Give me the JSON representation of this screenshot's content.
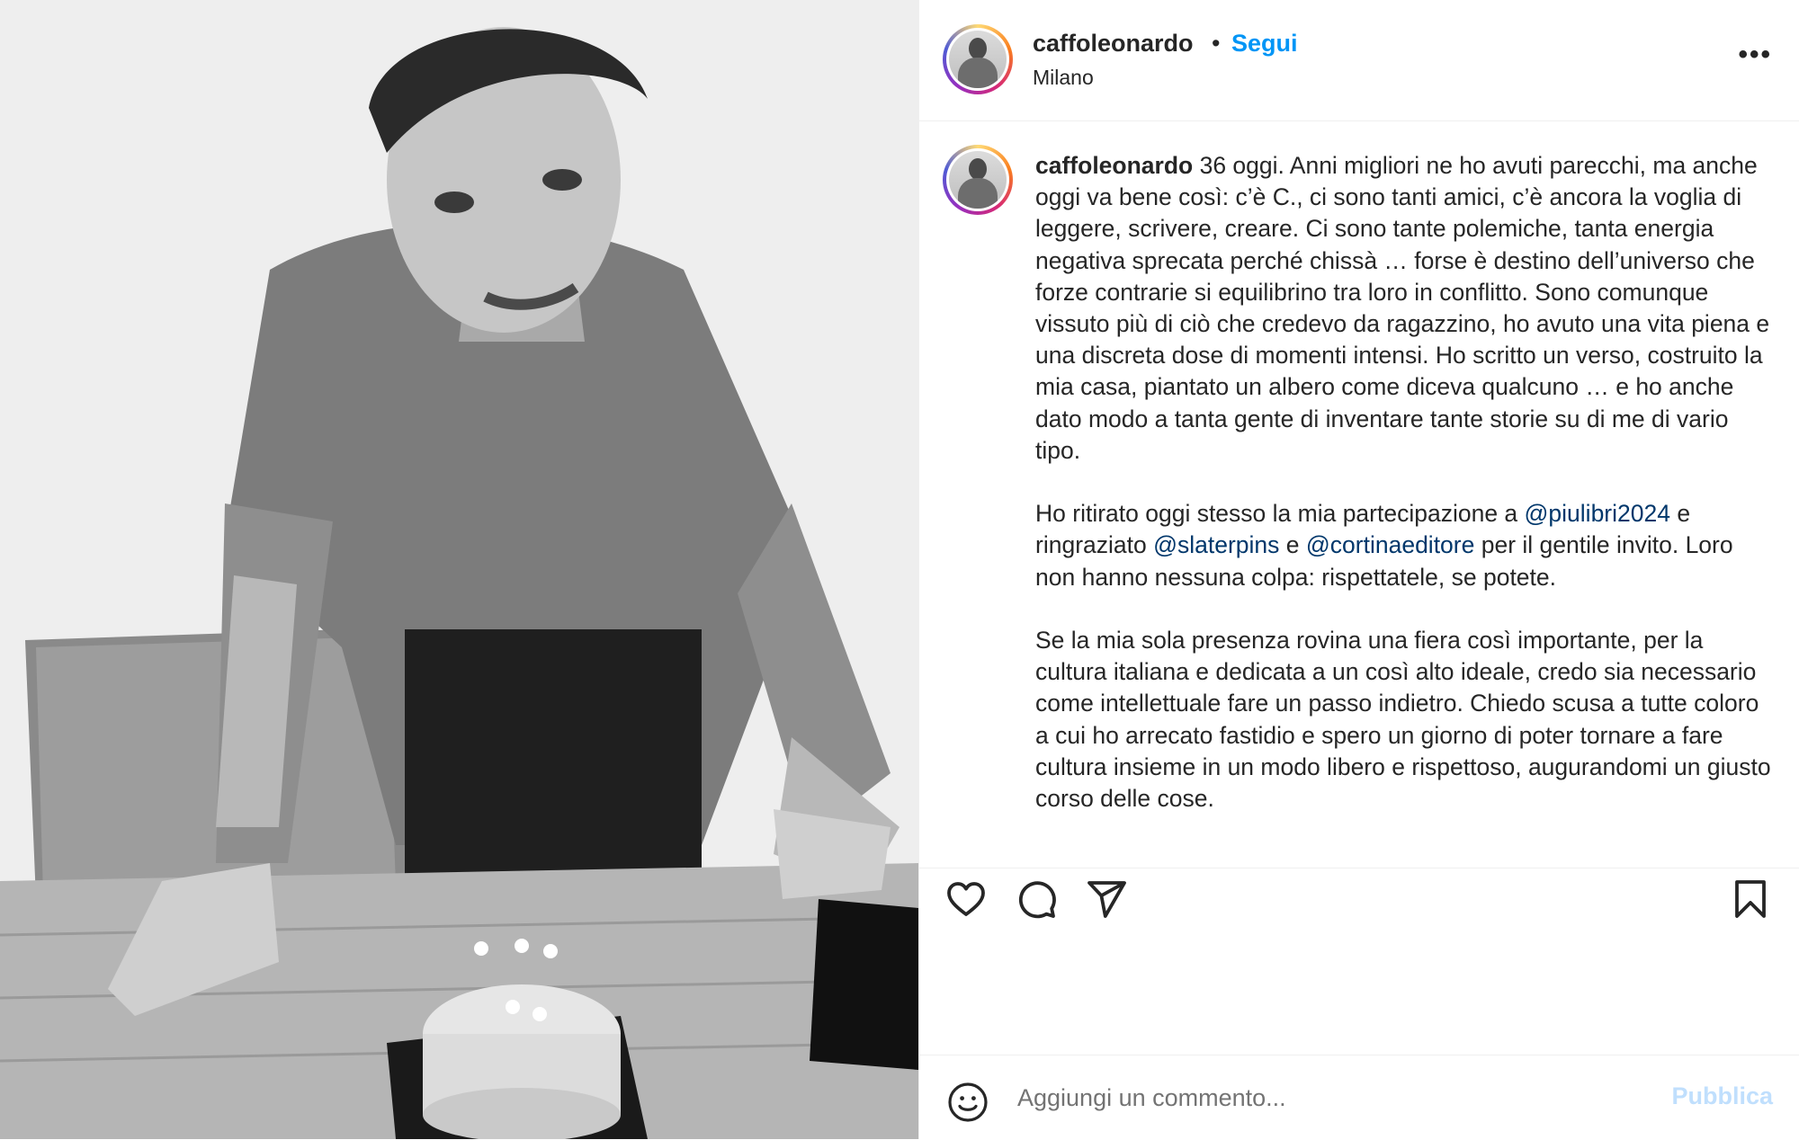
{
  "post_image": {
    "alt_subject": "photo"
  },
  "header": {
    "username": "caffoleonardo",
    "separator": "•",
    "follow_label": "Segui",
    "location": "Milano",
    "more_label": "•••"
  },
  "caption": {
    "username": "caffoleonardo",
    "p1": " 36 oggi. Anni migliori ne ho avuti parecchi, ma anche oggi va bene così: c’è C., ci sono tanti amici, c’è ancora la voglia di leggere, scrivere, creare. Ci sono tante polemiche, tanta energia negativa sprecata perché chissà … forse è destino dell’universo che forze contrarie si equilibrino tra loro in conflitto. Sono comunque vissuto più di ciò che credevo da ragazzino, ho avuto una vita piena e una discreta dose di momenti intensi. Ho scritto un verso, costruito la mia casa, piantato un albero come diceva qualcuno … e ho anche dato modo a tanta gente di inventare tante storie su di me di vario tipo.",
    "p2_a": "Ho ritirato oggi stesso la mia partecipazione a ",
    "mention1": "@piulibri2024",
    "p2_b": " e ringraziato ",
    "mention2": "@slaterpins",
    "p2_c": " e ",
    "mention3": "@cortinaeditore",
    "p2_d": " per il gentile invito. Loro non hanno nessuna colpa: rispettatele, se potete.",
    "p3": "Se la mia sola presenza rovina una fiera così importante, per la cultura italiana e dedicata a un così alto ideale, credo sia necessario come intellettuale fare un passo indietro. Chiedo scusa a tutte coloro a cui ho arrecato fastidio e spero un giorno di poter tornare a fare cultura insieme in un modo libero e rispettoso, augurandomi un giusto corso delle cose."
  },
  "actions": {
    "like": "heart-icon",
    "comment": "comment-icon",
    "share": "share-icon",
    "save": "bookmark-icon"
  },
  "comment_bar": {
    "placeholder": "Aggiungi un commento...",
    "publish_label": "Pubblica"
  }
}
